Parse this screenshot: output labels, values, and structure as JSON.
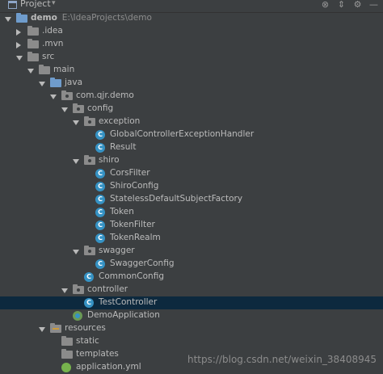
{
  "header": {
    "title": "Project",
    "dropdown": "▾",
    "icons": [
      "target-icon",
      "collapse-icon",
      "gear-icon",
      "hide-icon"
    ]
  },
  "tree": [
    {
      "label": "demo",
      "path": "E:\\IdeaProjects\\demo",
      "kind": "module",
      "arrow": "open",
      "indent": 0
    },
    {
      "label": ".idea",
      "kind": "folder",
      "arrow": "closed",
      "indent": 1
    },
    {
      "label": ".mvn",
      "kind": "folder",
      "arrow": "closed",
      "indent": 1
    },
    {
      "label": "src",
      "kind": "folder",
      "arrow": "open",
      "indent": 1
    },
    {
      "label": "main",
      "kind": "folder",
      "arrow": "open",
      "indent": 2
    },
    {
      "label": "java",
      "kind": "source",
      "arrow": "open",
      "indent": 3
    },
    {
      "label": "com.qjr.demo",
      "kind": "package",
      "arrow": "open",
      "indent": 4
    },
    {
      "label": "config",
      "kind": "package",
      "arrow": "open",
      "indent": 5
    },
    {
      "label": "exception",
      "kind": "package",
      "arrow": "open",
      "indent": 6
    },
    {
      "label": "GlobalControllerExceptionHandler",
      "kind": "class",
      "indent": 7
    },
    {
      "label": "Result",
      "kind": "class",
      "indent": 7
    },
    {
      "label": "shiro",
      "kind": "package",
      "arrow": "open",
      "indent": 6
    },
    {
      "label": "CorsFilter",
      "kind": "class",
      "indent": 7
    },
    {
      "label": "ShiroConfig",
      "kind": "class",
      "indent": 7
    },
    {
      "label": "StatelessDefaultSubjectFactory",
      "kind": "class",
      "indent": 7
    },
    {
      "label": "Token",
      "kind": "class",
      "indent": 7
    },
    {
      "label": "TokenFilter",
      "kind": "class",
      "indent": 7
    },
    {
      "label": "TokenRealm",
      "kind": "class",
      "indent": 7
    },
    {
      "label": "swagger",
      "kind": "package",
      "arrow": "open",
      "indent": 6
    },
    {
      "label": "SwaggerConfig",
      "kind": "class",
      "indent": 7
    },
    {
      "label": "CommonConfig",
      "kind": "class",
      "indent": 6
    },
    {
      "label": "controller",
      "kind": "package",
      "arrow": "open",
      "indent": 5
    },
    {
      "label": "TestController",
      "kind": "class",
      "indent": 6,
      "selected": true
    },
    {
      "label": "DemoApplication",
      "kind": "spring",
      "indent": 5
    },
    {
      "label": "resources",
      "kind": "resources",
      "arrow": "open",
      "indent": 3
    },
    {
      "label": "static",
      "kind": "folder",
      "indent": 4
    },
    {
      "label": "templates",
      "kind": "folder",
      "indent": 4
    },
    {
      "label": "application.yml",
      "kind": "yml",
      "indent": 4
    }
  ],
  "class_letter": "C",
  "watermark": "https://blog.csdn.net/weixin_38408945"
}
